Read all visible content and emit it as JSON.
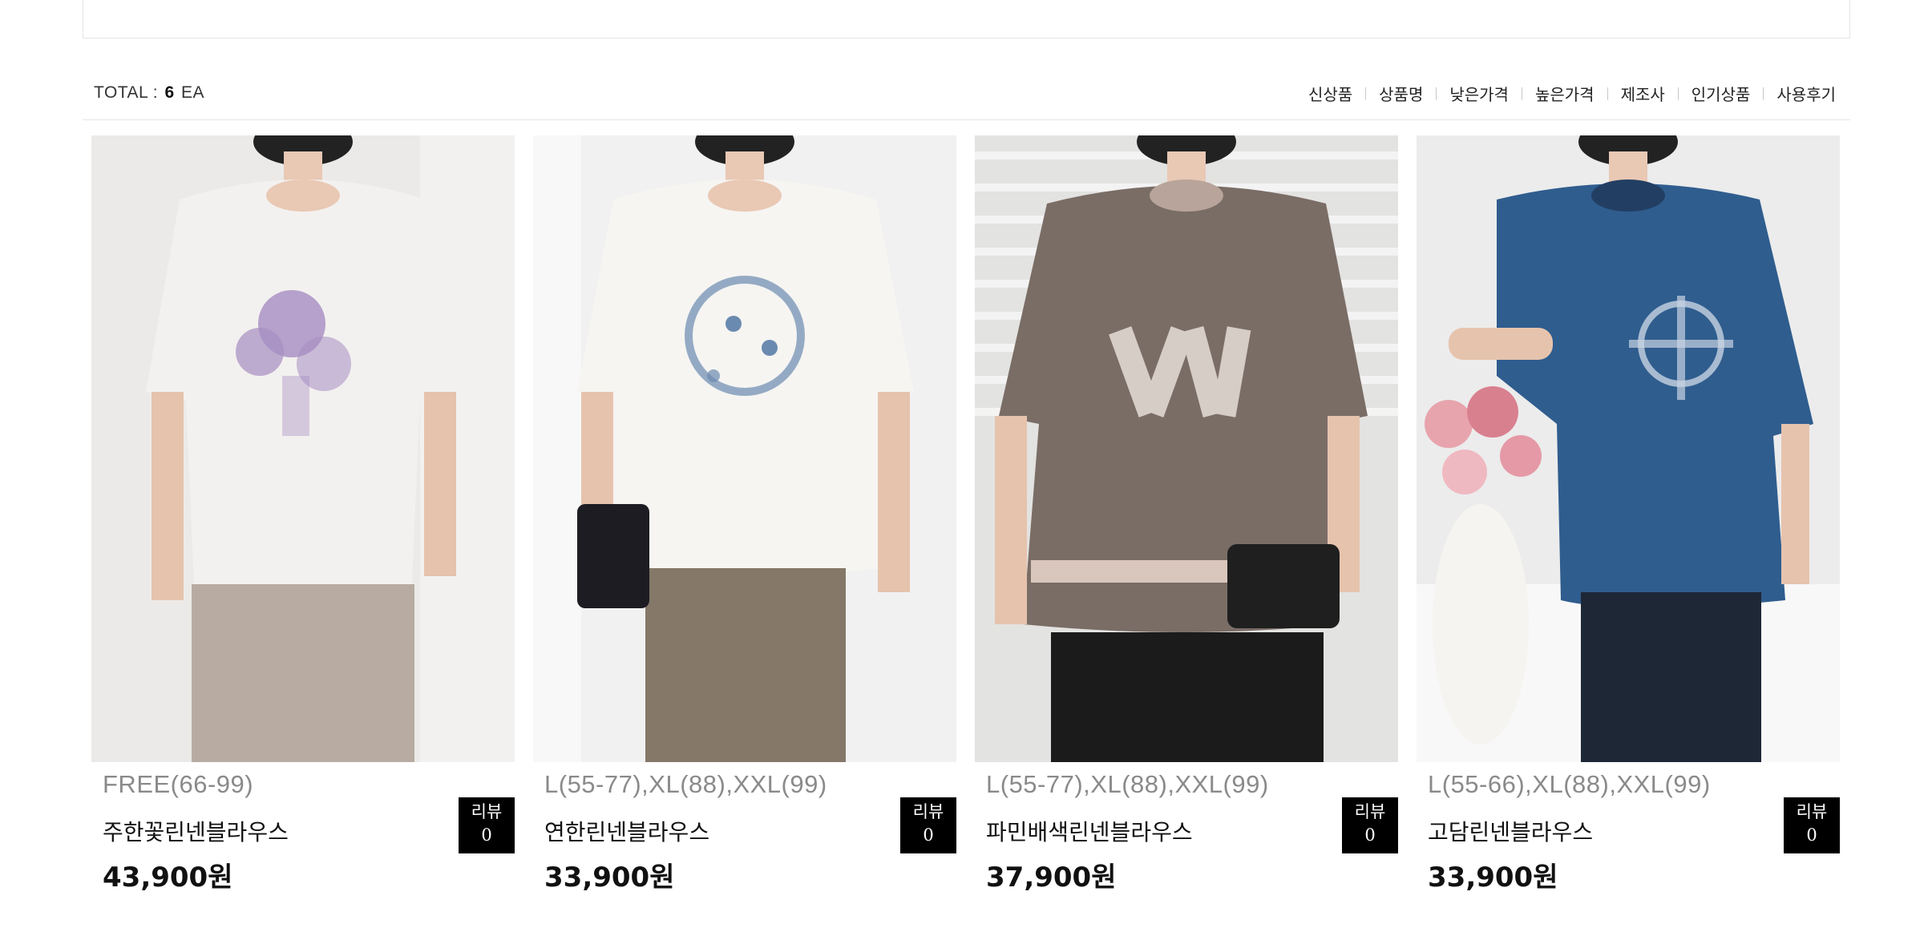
{
  "toolbar": {
    "total_prefix": "TOTAL : ",
    "total_count": "6",
    "total_suffix": " EA",
    "sort_options": [
      "신상품",
      "상품명",
      "낮은가격",
      "높은가격",
      "제조사",
      "인기상품",
      "사용후기"
    ]
  },
  "products": [
    {
      "sizes": "FREE(66-99)",
      "name": "주한꽃린넨블라우스",
      "price": "43,900원",
      "review_label": "리뷰",
      "review_count": "0",
      "image": {
        "shirt_color": "#f3f1ef",
        "pants_color": "#b8aca2",
        "bg_color": "#eceae8",
        "print_color": "#a58dc2"
      }
    },
    {
      "sizes": "L(55-77),XL(88),XXL(99)",
      "name": "연한린넨블라우스",
      "price": "33,900원",
      "review_label": "리뷰",
      "review_count": "0",
      "image": {
        "shirt_color": "#f6f5f2",
        "pants_color": "#857868",
        "bg_color": "#f1f1f1",
        "print_color": "#6b8ab0"
      }
    },
    {
      "sizes": "L(55-77),XL(88),XXL(99)",
      "name": "파민배색린넨블라우스",
      "price": "37,900원",
      "review_label": "리뷰",
      "review_count": "0",
      "image": {
        "shirt_color": "#7a6d66",
        "pants_color": "#1b1b1b",
        "bg_color": "#e3e3e1",
        "print_color": "#d7cdc7"
      }
    },
    {
      "sizes": "L(55-66),XL(88),XXL(99)",
      "name": "고담린넨블라우스",
      "price": "33,900원",
      "review_label": "리뷰",
      "review_count": "0",
      "image": {
        "shirt_color": "#2f5d8e",
        "pants_color": "#1e2736",
        "bg_color": "#ececec",
        "print_color": "#c7d3e2"
      }
    }
  ]
}
